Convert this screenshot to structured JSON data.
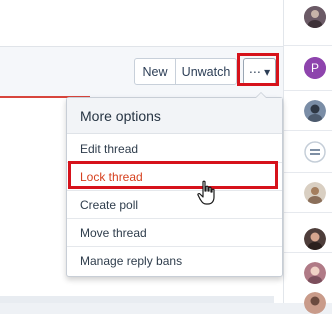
{
  "toolbar": {
    "new_label": "New",
    "unwatch_label": "Unwatch",
    "more_label": "⋯ ▾"
  },
  "menu": {
    "header": "More options",
    "items": [
      {
        "label": "Edit thread"
      },
      {
        "label": "Lock thread"
      },
      {
        "label": "Create poll"
      },
      {
        "label": "Move thread"
      },
      {
        "label": "Manage reply bans"
      }
    ]
  },
  "colors": {
    "highlight": "#d6121b",
    "danger_text": "#d6411f",
    "accent_bar": "#d8453c"
  },
  "avatars": [
    {
      "name": "avatar-1",
      "color": "#6b5a66"
    },
    {
      "name": "avatar-2",
      "letter": "P",
      "color": "#8e44ad"
    },
    {
      "name": "avatar-3",
      "color": "#7a8da6"
    },
    {
      "name": "avatar-4",
      "color": "#8aa0b5"
    },
    {
      "name": "avatar-5",
      "color": "#c9b49a"
    },
    {
      "name": "avatar-6",
      "color": "#4e3d3a"
    },
    {
      "name": "avatar-7",
      "color": "#b07a86"
    },
    {
      "name": "avatar-8",
      "color": "#c99b8a"
    }
  ]
}
